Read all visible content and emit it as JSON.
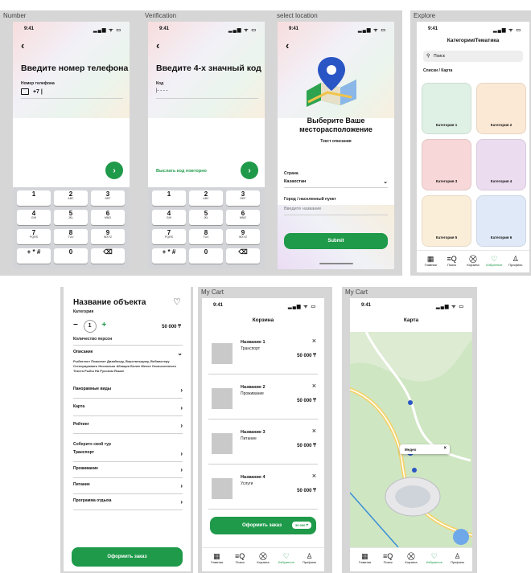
{
  "screens": {
    "number": {
      "label": "Number",
      "time": "9:41",
      "status_icons": "▂▄▆ ᯤ ▭",
      "title": "Введите номер телефона",
      "field_label": "Номер телефона",
      "value": "+7",
      "submit": "›"
    },
    "verification": {
      "label": "Verification",
      "time": "9:41",
      "status_icons": "▂▄▆ ᯤ ▭",
      "title": "Введите 4-х значный код",
      "field_label": "Код",
      "value": "|- - - -",
      "resend": "Выслать код повторно",
      "submit": "›"
    },
    "location": {
      "label": "select location",
      "time": "9:41",
      "status_icons": "▂▄▆ ᯤ ▭",
      "title_line1": "Выберите Ваше",
      "title_line2": "месторасположение",
      "subtitle": "Текст описания",
      "country_label": "Страна",
      "country_value": "Казахстан",
      "city_label": "Город / населенный пункт",
      "city_placeholder": "Введите название",
      "submit": "Submit"
    },
    "explore": {
      "label": "Explore",
      "time": "9:41",
      "status_icons": "▂▄▆ ᯤ ▭",
      "title": "Категории/Тематика",
      "search_placeholder": "Поиск",
      "breadcrumb": "Списки / Карта",
      "categories": [
        "Категория 1",
        "Категория 2",
        "Категория 3",
        "Категория 4",
        "Категория 5",
        "Категория 6"
      ],
      "category_colors": [
        "#dff0e4",
        "#fbe8d5",
        "#f7d7d7",
        "#ecdcf0",
        "#fbeed9",
        "#dfe9f7"
      ]
    },
    "object": {
      "title": "Название объекта",
      "subtitle": "Категория",
      "qty": "1",
      "minus": "−",
      "plus": "+",
      "price": "50 000 ₸",
      "persons_label": "Количество персон",
      "desc_label": "Описание",
      "desc_text": "Рыбатекст Помогает Дизайнеру, Верстальщику, Вебмастеру Сгенерировать Несколько Абзацев Более Менее Осмысленного Текста Рыбы На Русском Языке",
      "rows": [
        "Панорамные виды",
        "Карта",
        "Рейтинг"
      ],
      "section_label": "Соберите свой тур",
      "tour_rows": [
        "Транспорт",
        "Проживание",
        "Питание",
        "Программа отдыха"
      ],
      "order": "Оформить заказ"
    },
    "cart": {
      "label": "My Cart",
      "time": "9:41",
      "status_icons": "▂▄▆ ᯤ ▭",
      "title": "Корзина",
      "items": [
        {
          "name": "Название 1",
          "type": "Транспорт",
          "price": "50 000 ₸"
        },
        {
          "name": "Название 2",
          "type": "Проживание",
          "price": "50 000 ₸"
        },
        {
          "name": "Название 3",
          "type": "Питание",
          "price": "50 000 ₸"
        },
        {
          "name": "Название 4",
          "type": "Услуги",
          "price": "50 000 ₸"
        }
      ],
      "order": "Оформить заказ",
      "order_total": "50 000 ₸"
    },
    "map": {
      "label": "My Cart",
      "time": "9:41",
      "status_icons": "▂▄▆ ᯤ ▭",
      "title": "Карта",
      "popup": "Медео"
    }
  },
  "keypad": [
    {
      "d": "1",
      "l": ""
    },
    {
      "d": "2",
      "l": "ABC"
    },
    {
      "d": "3",
      "l": "DEF"
    },
    {
      "d": "4",
      "l": "GHI"
    },
    {
      "d": "5",
      "l": "JKL"
    },
    {
      "d": "6",
      "l": "MNO"
    },
    {
      "d": "7",
      "l": "PQRS"
    },
    {
      "d": "8",
      "l": "TUV"
    },
    {
      "d": "9",
      "l": "WXYZ"
    },
    {
      "d": "+ * #",
      "l": ""
    },
    {
      "d": "0",
      "l": ""
    },
    {
      "d": "⌫",
      "l": ""
    }
  ],
  "tabbar": [
    {
      "icon": "▦",
      "label": "Главная"
    },
    {
      "icon": "≡Q",
      "label": "Поиск"
    },
    {
      "icon": "⛒",
      "label": "Корзина"
    },
    {
      "icon": "♡",
      "label": "Избранное"
    },
    {
      "icon": "♙",
      "label": "Профиль"
    }
  ],
  "colors": {
    "accent": "#1f9a4a",
    "panel": "#d6d6d6"
  }
}
